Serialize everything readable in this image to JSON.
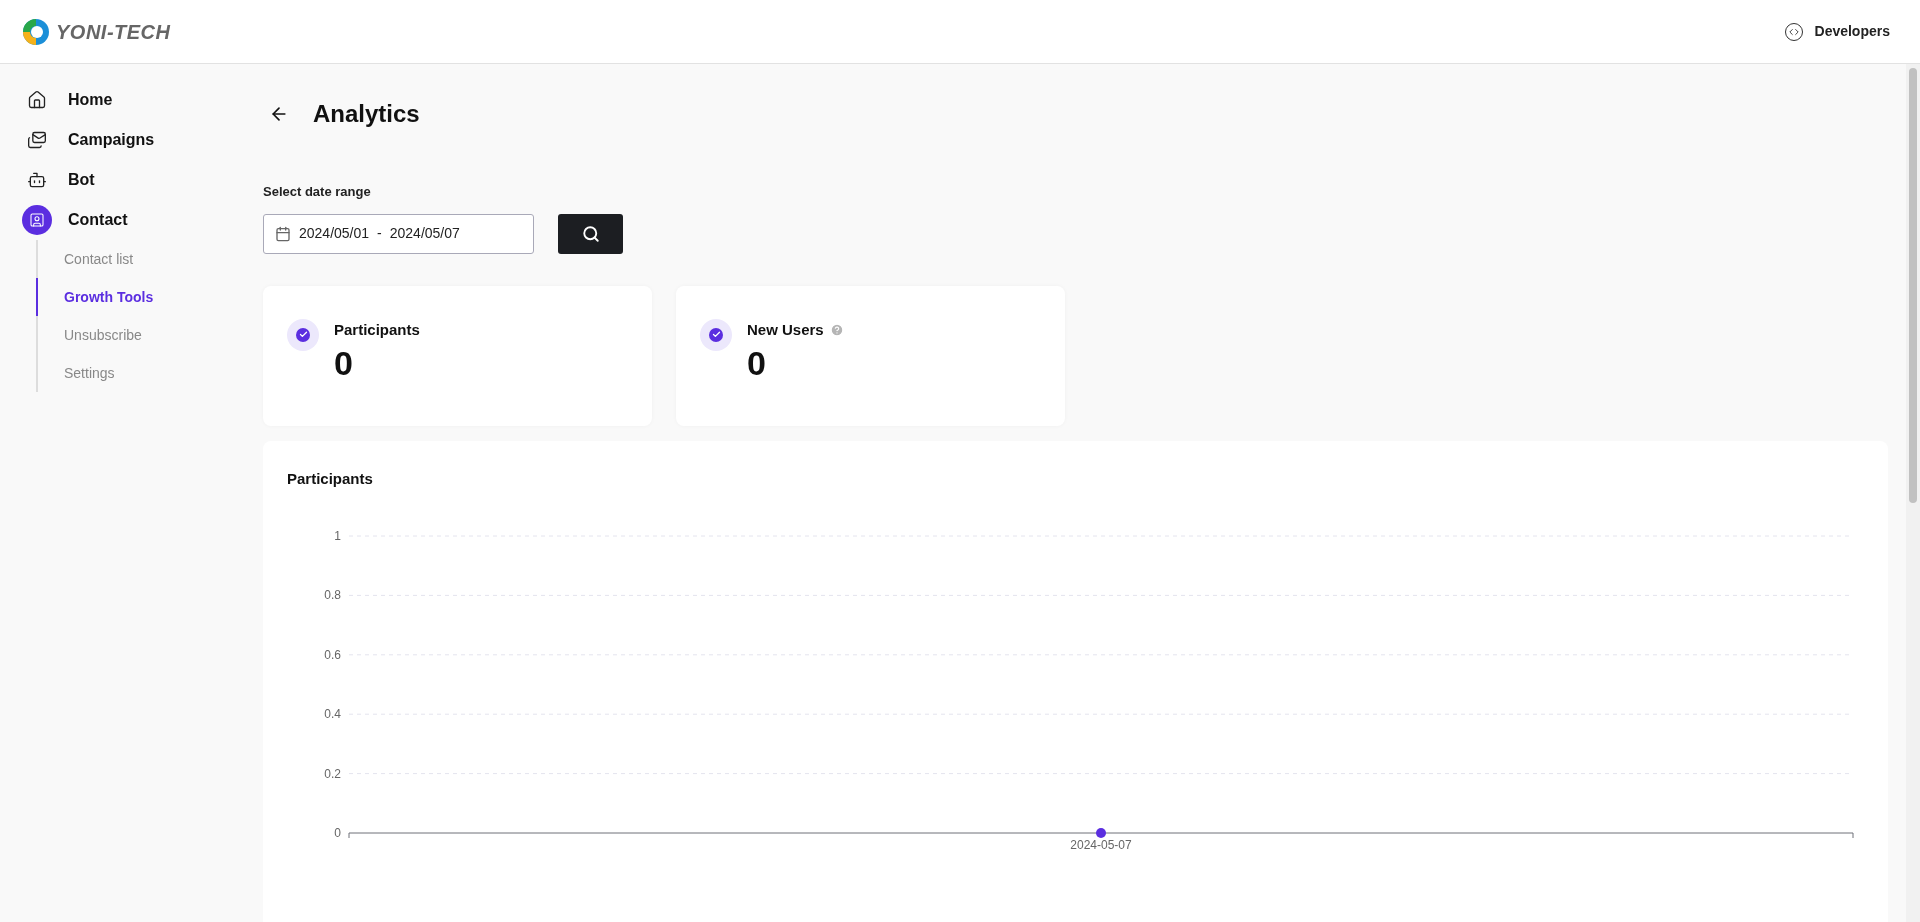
{
  "header": {
    "brand": "YONI-TECH",
    "developers_link": "Developers"
  },
  "sidebar": {
    "items": [
      {
        "label": "Home",
        "kind": "home",
        "selected": false
      },
      {
        "label": "Campaigns",
        "kind": "campaigns",
        "selected": false
      },
      {
        "label": "Bot",
        "kind": "bot",
        "selected": false
      },
      {
        "label": "Contact",
        "kind": "contact",
        "selected": true,
        "children": [
          {
            "label": "Contact list",
            "selected": false
          },
          {
            "label": "Growth Tools",
            "selected": true
          },
          {
            "label": "Unsubscribe",
            "selected": false
          },
          {
            "label": "Settings",
            "selected": false
          }
        ]
      }
    ]
  },
  "page": {
    "title": "Analytics"
  },
  "date_range": {
    "label": "Select date range",
    "start": "2024/05/01",
    "separator": "-",
    "end": "2024/05/07"
  },
  "stats": [
    {
      "label": "Participants",
      "value": "0",
      "help": false
    },
    {
      "label": "New Users",
      "value": "0",
      "help": true
    }
  ],
  "chart_panel": {
    "title": "Participants",
    "chart_data": {
      "type": "line",
      "categories": [
        "2024-05-07"
      ],
      "ylim": [
        0,
        1
      ],
      "yticks": [
        0,
        {
          "value": 0.2,
          "label": "0.2"
        },
        {
          "value": 0.4,
          "label": "0.4"
        },
        {
          "value": 0.6,
          "label": "0.6"
        },
        {
          "value": 0.8,
          "label": "0.8"
        },
        1
      ],
      "grid": true,
      "series": [
        {
          "color": "#5b2ee0",
          "marker": true,
          "values": [
            0
          ]
        }
      ]
    }
  }
}
